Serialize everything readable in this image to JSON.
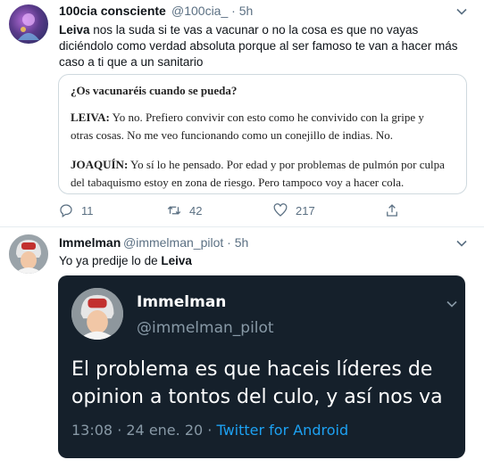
{
  "tweet1": {
    "display_name": "100cia consciente",
    "handle": "@100cia_",
    "time": "5h",
    "text_bold": "Leiva",
    "text": " nos la suda si te vas a vacunar o no la cosa es que no vayas diciéndolo como verdad absoluta porque al ser famoso te van a hacer más caso a ti que a un sanitario",
    "card": {
      "question": "¿Os vacunaréis cuando se pueda?",
      "p1_speaker": "LEIVA:",
      "p1_text": " Yo no. Prefiero convivir con esto como he convivido con la gripe y otras cosas. No me veo funcionando como un conejillo de indias. No.",
      "p2_speaker": "JOAQUÍN:",
      "p2_text": " Yo sí lo he pensado. Por edad y por problemas de pulmón por culpa del tabaquismo estoy en zona de riesgo. Pero tampoco voy a hacer cola."
    },
    "actions": {
      "replies": "11",
      "retweets": "42",
      "likes": "217"
    }
  },
  "tweet2": {
    "display_name": "Immelman",
    "handle": "@immelman_pilot",
    "time": "5h",
    "text_prefix": "Yo ya predije lo de ",
    "text_bold": "Leiva",
    "embedded": {
      "display_name": "Immelman",
      "handle": "@immelman_pilot",
      "text": "El problema es que haceis líderes de opinion a tontos del culo, y así nos va",
      "timestamp": "13:08 · 24 ene. 20 · ",
      "source": "Twitter for Android"
    }
  },
  "colors": {
    "link": "#1da1f2",
    "dark_bg": "#15202b",
    "muted": "#5b7083"
  }
}
